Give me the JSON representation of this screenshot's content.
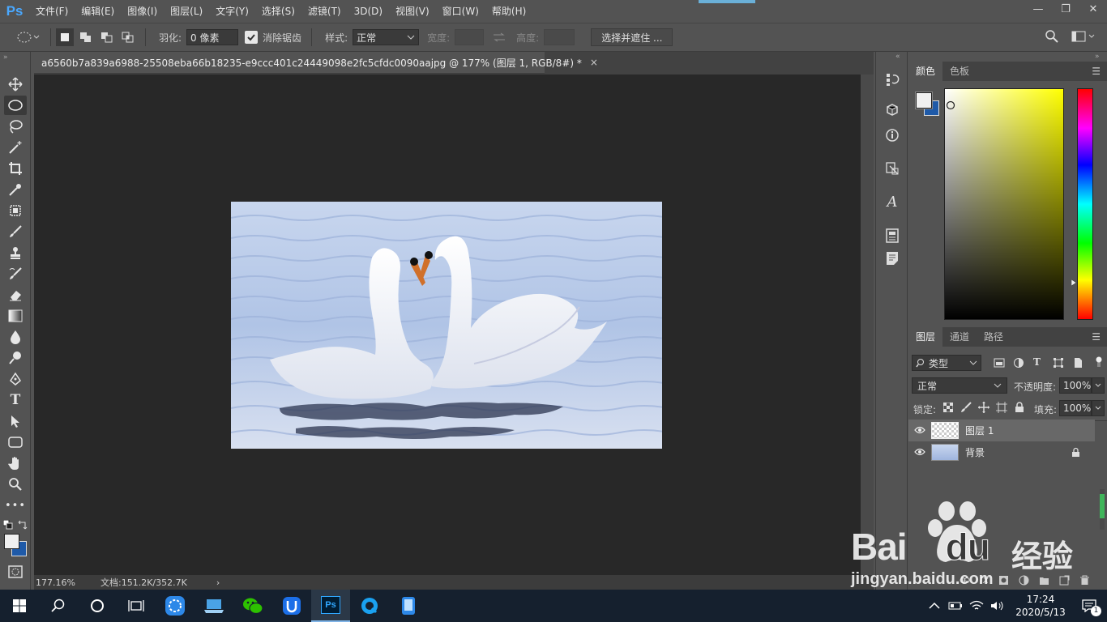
{
  "app": {
    "logo": "Ps"
  },
  "menu": [
    "文件(F)",
    "编辑(E)",
    "图像(I)",
    "图层(L)",
    "文字(Y)",
    "选择(S)",
    "滤镜(T)",
    "3D(D)",
    "视图(V)",
    "窗口(W)",
    "帮助(H)"
  ],
  "window_controls": {
    "minimize": "—",
    "restore": "❐",
    "close": "✕"
  },
  "options": {
    "feather_label": "羽化:",
    "feather_value": "0 像素",
    "antialias_label": "消除锯齿",
    "antialias_checked": true,
    "style_label": "样式:",
    "style_value": "正常",
    "width_label": "宽度:",
    "height_label": "高度:",
    "select_mask_label": "选择并遮住 ..."
  },
  "document": {
    "tab_title": "a6560b7a839a6988-25508eba66b18235-e9ccc401c24449098e2fc5cfdc0090aajpg @ 177% (图层 1, RGB/8#) *",
    "close_glyph": "×",
    "zoom": "177.16%",
    "doc_size": "文档:151.2K/352.7K",
    "status_arrow": "›"
  },
  "tools": [
    "move-icon",
    "elliptical-marquee-icon",
    "lasso-icon",
    "magic-wand-icon",
    "crop-icon",
    "eyedropper-icon",
    "patch-icon",
    "brush-icon",
    "stamp-icon",
    "history-brush-icon",
    "eraser-icon",
    "gradient-icon",
    "blur-icon",
    "dodge-icon",
    "pen-icon",
    "type-icon",
    "path-select-icon",
    "rectangle-shape-icon",
    "hand-icon",
    "zoom-icon",
    "more-icon"
  ],
  "tool_glyphs": [
    "✥",
    "◯",
    "ꝏ",
    "✧",
    "⌗",
    "✎",
    "⛶",
    "🖌",
    "▲",
    "↯",
    "◇",
    "▦",
    "💧",
    "🔍",
    "✒",
    "T",
    "➤",
    "▭",
    "✋",
    "🔎",
    "•••"
  ],
  "midstrip_icons": [
    "history-icon",
    "3d-icon",
    "info-icon",
    "adjust-icon",
    "glyphs-icon",
    "properties-icon",
    "notes-icon"
  ],
  "color_panel": {
    "tabs": [
      "颜色",
      "色板"
    ],
    "active_tab": 0,
    "foreground": "#f0f0f0",
    "background": "#1f5aa8",
    "hue": "#ffff00"
  },
  "layers_panel": {
    "tabs": [
      "图层",
      "通道",
      "路径"
    ],
    "active_tab": 0,
    "filter_label": "类型",
    "blend_mode": "正常",
    "opacity_label": "不透明度:",
    "opacity_value": "100%",
    "lock_label": "锁定:",
    "fill_label": "填充:",
    "fill_value": "100%",
    "layers": [
      {
        "name": "图层 1",
        "selected": true,
        "locked": false
      },
      {
        "name": "背景",
        "selected": false,
        "locked": true
      }
    ]
  },
  "taskbar": {
    "apps": [
      "start-icon",
      "search-icon",
      "cortana-icon",
      "task-view-icon",
      "app-icon",
      "laptop-icon",
      "wechat-icon",
      "uu-icon",
      "photoshop-icon",
      "browser-icon",
      "phone-icon"
    ],
    "ps_label": "Ps",
    "time": "17:24",
    "date": "2020/5/13",
    "notification_count": "1"
  },
  "watermark": {
    "brand": "Bai",
    "brand2": "du",
    "cn": "经验",
    "url": "jingyan.baidu.com"
  },
  "colors": {
    "accent": "#4aa8ff",
    "panel": "#535353",
    "canvas": "#282828",
    "taskbar": "#15202e"
  }
}
